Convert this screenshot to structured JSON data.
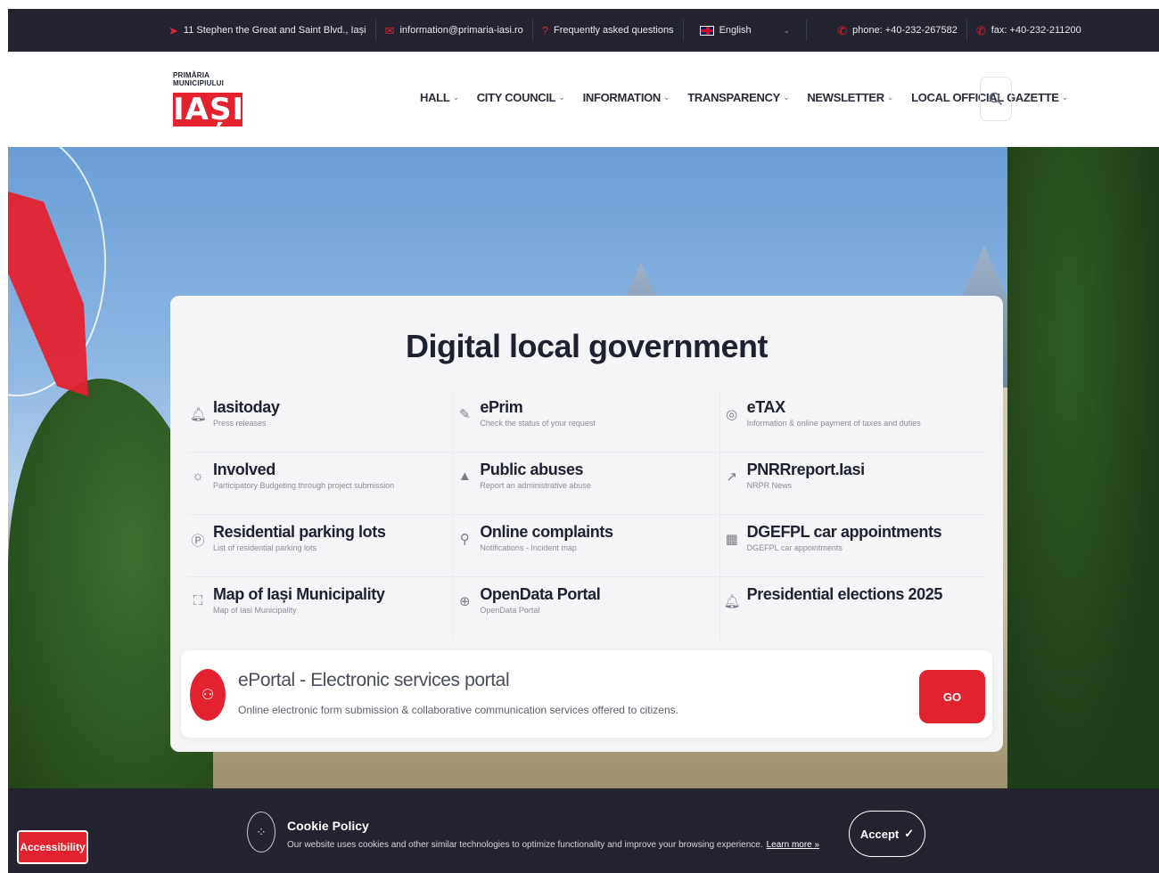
{
  "topbar": {
    "address": "11 Stephen the Great and Saint Blvd., Iași",
    "email": "information@primaria-iasi.ro",
    "faq": "Frequently asked questions",
    "language": "English",
    "phone": "phone: +40-232-267582",
    "fax": "fax: +40-232-211200"
  },
  "logo": {
    "line1": "PRIMĂRIA",
    "line2": "MUNICIPIULUI",
    "city": "IAȘI"
  },
  "nav": {
    "items": [
      "HALL",
      "CITY COUNCIL",
      "INFORMATION",
      "TRANSPARENCY",
      "NEWSLETTER",
      "LOCAL OFFICIAL GAZETTE"
    ]
  },
  "card": {
    "title": "Digital local government",
    "services": [
      {
        "title": "Iasitoday",
        "subtitle": "Press releases",
        "icon": "bell-icon"
      },
      {
        "title": "ePrim",
        "subtitle": "Check the status of your request",
        "icon": "document-edit-icon"
      },
      {
        "title": "eTAX",
        "subtitle": "Information & online payment of taxes and duties",
        "icon": "coins-icon"
      },
      {
        "title": "Involved",
        "subtitle": "Participatory Budgeting through project submission",
        "icon": "lightbulb-icon"
      },
      {
        "title": "Public abuses",
        "subtitle": "Report an administrative abuse",
        "icon": "warning-icon"
      },
      {
        "title": "PNRRreport.Iasi",
        "subtitle": "NRPR News",
        "icon": "trend-icon"
      },
      {
        "title": "Residential parking lots",
        "subtitle": "List of residential parking lots",
        "icon": "parking-icon"
      },
      {
        "title": "Online complaints",
        "subtitle": "Notifications - Incident map",
        "icon": "map-pin-icon"
      },
      {
        "title": "DGEFPL car appointments",
        "subtitle": "DGEFPL car appointments",
        "icon": "calendar-icon"
      },
      {
        "title": "Map of Iași Municipality",
        "subtitle": "Map of Iasi Municipality",
        "icon": "map-icon"
      },
      {
        "title": "OpenData Portal",
        "subtitle": "OpenData Portal",
        "icon": "globe-icon"
      },
      {
        "title": "Presidential elections 2025",
        "subtitle": "",
        "icon": "bell-icon"
      }
    ]
  },
  "eportal": {
    "title": "ePortal - Electronic services portal",
    "subtitle": "Online electronic form submission & collaborative communication services offered to citizens.",
    "go_label": "GO"
  },
  "cookie": {
    "title": "Cookie Policy",
    "text": "Our website uses cookies and other similar technologies to optimize functionality and improve your browsing experience.",
    "learn_more": "Learn more »",
    "accept_label": "Accept"
  },
  "accessibility_label": "Accessibility",
  "colors": {
    "brand_red": "#e3222f",
    "dark_bar": "#23242f"
  }
}
